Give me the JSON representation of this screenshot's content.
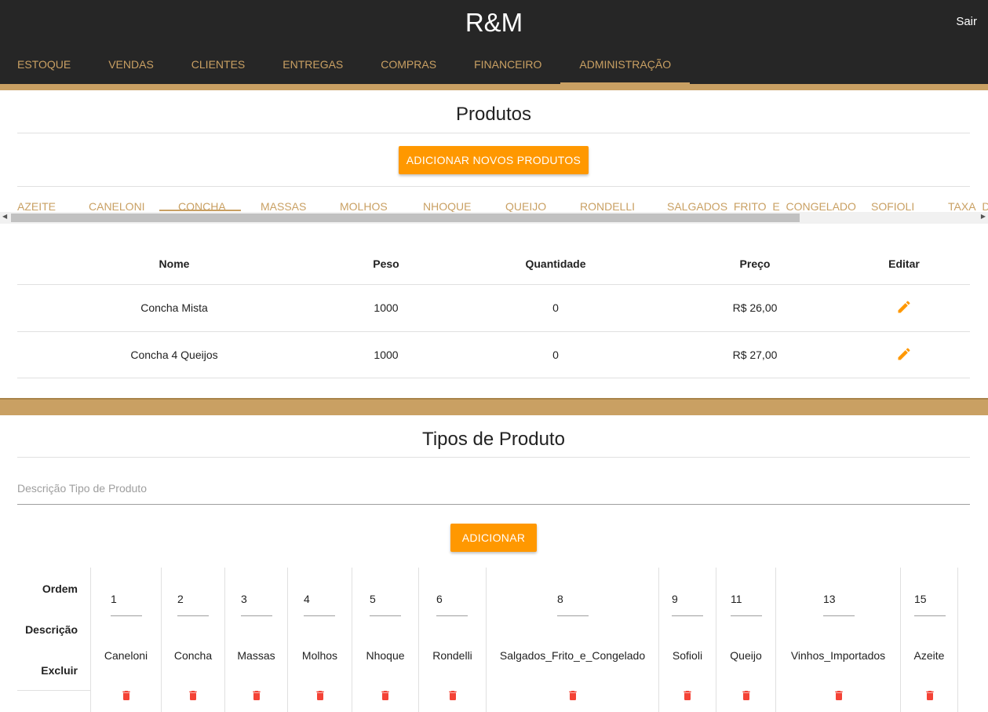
{
  "header": {
    "brand": "R&M",
    "logout": "Sair",
    "nav": [
      "ESTOQUE",
      "VENDAS",
      "CLIENTES",
      "ENTREGAS",
      "COMPRAS",
      "FINANCEIRO",
      "ADMINISTRAÇÃO"
    ],
    "active_nav": "ADMINISTRAÇÃO"
  },
  "produtos": {
    "title": "Produtos",
    "add_button": "ADICIONAR NOVOS PRODUTOS",
    "tabs": [
      "AZEITE",
      "CANELONI",
      "CONCHA",
      "MASSAS",
      "MOLHOS",
      "NHOQUE",
      "QUEIJO",
      "RONDELLI",
      "SALGADOS_FRITO_E_CONGELADO",
      "SOFIOLI",
      "TAXA_DE_ENTREGA"
    ],
    "active_tab": "CONCHA",
    "columns": [
      "Nome",
      "Peso",
      "Quantidade",
      "Preço",
      "Editar"
    ],
    "rows": [
      {
        "nome": "Concha Mista",
        "peso": "1000",
        "quantidade": "0",
        "preco": "R$ 26,00"
      },
      {
        "nome": "Concha 4 Queijos",
        "peso": "1000",
        "quantidade": "0",
        "preco": "R$ 27,00"
      }
    ]
  },
  "tipos": {
    "title": "Tipos de Produto",
    "input_placeholder": "Descrição Tipo de Produto",
    "add_button": "ADICIONAR",
    "row_labels": [
      "Ordem",
      "Descrição",
      "Excluir"
    ],
    "items": [
      {
        "ordem": "1",
        "descricao": "Caneloni"
      },
      {
        "ordem": "2",
        "descricao": "Concha"
      },
      {
        "ordem": "3",
        "descricao": "Massas"
      },
      {
        "ordem": "4",
        "descricao": "Molhos"
      },
      {
        "ordem": "5",
        "descricao": "Nhoque"
      },
      {
        "ordem": "6",
        "descricao": "Rondelli"
      },
      {
        "ordem": "8",
        "descricao": "Salgados_Frito_e_Congelado"
      },
      {
        "ordem": "9",
        "descricao": "Sofioli"
      },
      {
        "ordem": "11",
        "descricao": "Queijo"
      },
      {
        "ordem": "13",
        "descricao": "Vinhos_Importados"
      },
      {
        "ordem": "15",
        "descricao": "Azeite"
      }
    ]
  },
  "colors": {
    "topbar": "#262626",
    "gold": "#c9a063",
    "accent": "#ff9800",
    "delete": "#f44336"
  }
}
